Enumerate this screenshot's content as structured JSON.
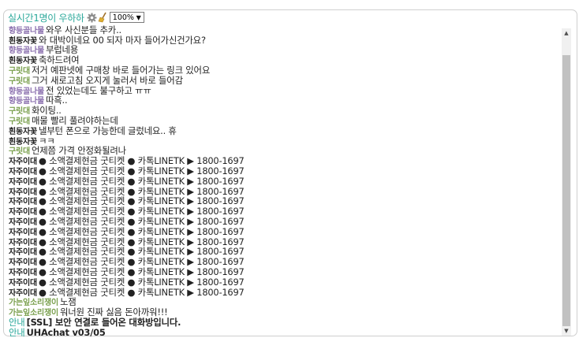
{
  "header": {
    "title": "실시간1명이 우하하",
    "gear_icon": "gear-icon",
    "broom_icon": "broom-icon",
    "zoom": "100%",
    "zoom_arrow": "▼"
  },
  "messages": [
    {
      "nick": "",
      "text": "",
      "nick_color": "green"
    },
    {
      "nick": "향등골나물",
      "text": "와우 사신분들 추카..",
      "nick_color": "purple"
    },
    {
      "nick": "흰동자꽃",
      "text": "와 대박이네요 00 되자 마자 들어가신건가요?",
      "nick_color": "dark"
    },
    {
      "nick": "향등골나물",
      "text": "부럽네용",
      "nick_color": "purple"
    },
    {
      "nick": "흰동자꽃",
      "text": "축하드려여",
      "nick_color": "dark"
    },
    {
      "nick": "구릿대",
      "text": "저거 예판넷에 구매창 바로 들어가는 링크 있어요",
      "nick_color": "olive"
    },
    {
      "nick": "구릿대",
      "text": "그거 새로고침 오지게 눌러서 바로 들어감",
      "nick_color": "olive"
    },
    {
      "nick": "향등골나물",
      "text": "전 있었는데도 불구하고 ㅠㅠ",
      "nick_color": "purple"
    },
    {
      "nick": "향등골나물",
      "text": "따흑..",
      "nick_color": "purple"
    },
    {
      "nick": "구릿대",
      "text": "화이팅..",
      "nick_color": "olive"
    },
    {
      "nick": "구릿대",
      "text": "매물 빨리 풀려야하는데",
      "nick_color": "olive"
    },
    {
      "nick": "흰동자꽃",
      "text": "낼부턴 폰으로 가능한데 글렀네요.. 휴",
      "nick_color": "dark"
    },
    {
      "nick": "흰동자꽃",
      "text": "ㅋㅋ",
      "nick_color": "dark"
    },
    {
      "nick": "구릿대",
      "text": "언제쯤 가격 안정화될려나",
      "nick_color": "olive"
    },
    {
      "nick": "자주이대",
      "text": "● 소액결제현금 굿티켓 ● 카톡LINETK ▶ 1800-1697",
      "nick_color": "dark"
    },
    {
      "nick": "자주이대",
      "text": "● 소액결제현금 굿티켓 ● 카톡LINETK ▶ 1800-1697",
      "nick_color": "dark"
    },
    {
      "nick": "자주이대",
      "text": "● 소액결제현금 굿티켓 ● 카톡LINETK ▶ 1800-1697",
      "nick_color": "dark"
    },
    {
      "nick": "자주이대",
      "text": "● 소액결제현금 굿티켓 ● 카톡LINETK ▶ 1800-1697",
      "nick_color": "dark"
    },
    {
      "nick": "자주이대",
      "text": "● 소액결제현금 굿티켓 ● 카톡LINETK ▶ 1800-1697",
      "nick_color": "dark"
    },
    {
      "nick": "자주이대",
      "text": "● 소액결제현금 굿티켓 ● 카톡LINETK ▶ 1800-1697",
      "nick_color": "dark"
    },
    {
      "nick": "자주이대",
      "text": "● 소액결제현금 굿티켓 ● 카톡LINETK ▶ 1800-1697",
      "nick_color": "dark"
    },
    {
      "nick": "자주이대",
      "text": "● 소액결제현금 굿티켓 ● 카톡LINETK ▶ 1800-1697",
      "nick_color": "dark"
    },
    {
      "nick": "자주이대",
      "text": "● 소액결제현금 굿티켓 ● 카톡LINETK ▶ 1800-1697",
      "nick_color": "dark"
    },
    {
      "nick": "자주이대",
      "text": "● 소액결제현금 굿티켓 ● 카톡LINETK ▶ 1800-1697",
      "nick_color": "dark"
    },
    {
      "nick": "자주이대",
      "text": "● 소액결제현금 굿티켓 ● 카톡LINETK ▶ 1800-1697",
      "nick_color": "dark"
    },
    {
      "nick": "자주이대",
      "text": "● 소액결제현금 굿티켓 ● 카톡LINETK ▶ 1800-1697",
      "nick_color": "dark"
    },
    {
      "nick": "자주이대",
      "text": "● 소액결제현금 굿티켓 ● 카톡LINETK ▶ 1800-1697",
      "nick_color": "dark"
    },
    {
      "nick": "자주이대",
      "text": "● 소액결제현금 굿티켓 ● 카톡LINETK ▶ 1800-1697",
      "nick_color": "dark"
    },
    {
      "nick": "가는잎소리쟁이",
      "text": "노잼",
      "nick_color": "olive"
    },
    {
      "nick": "가는잎소리쟁이",
      "text": "워너원 진짜 싫음 돈아까워!!!",
      "nick_color": "olive"
    },
    {
      "nick": "안내",
      "text": "[SSL] 보안 연결로 들어온 대화방입니다.",
      "nick_color": "notice"
    },
    {
      "nick": "안내",
      "text": "UHAchat v03/05",
      "nick_color": "notice"
    }
  ],
  "scrollbar": {
    "up_icon": "▲",
    "down_icon": "▼"
  },
  "colors": {
    "accent": "#2aa89a",
    "nick_green": "#7aa04d",
    "nick_purple": "#8a6fae"
  }
}
